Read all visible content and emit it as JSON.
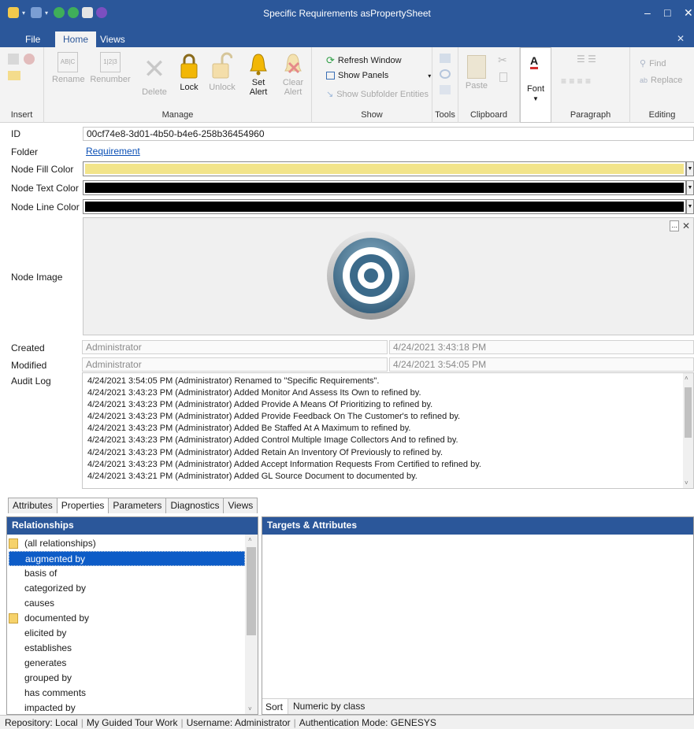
{
  "window": {
    "title": "Specific Requirements asPropertySheet",
    "minimize_glyph": "–",
    "maximize_glyph": "□",
    "close_glyph": "✕"
  },
  "ribbon_tabs": [
    {
      "label": "File"
    },
    {
      "label": "Home"
    },
    {
      "label": "Views"
    }
  ],
  "ribbon": {
    "groups": {
      "insert": "Insert",
      "manage": "Manage",
      "show": "Show",
      "tools": "Tools",
      "clipboard": "Clipboard",
      "paragraph": "Paragraph",
      "editing": "Editing"
    },
    "buttons": {
      "rename": "Rename",
      "renumber": "Renumber",
      "delete": "Delete",
      "lock": "Lock",
      "unlock": "Unlock",
      "set_alert": "Set Alert",
      "clear_alert": "Clear Alert",
      "refresh_window": "Refresh Window",
      "show_panels": "Show Panels",
      "show_subfolder_entities": "Show Subfolder Entities",
      "paste": "Paste",
      "font": "Font",
      "find": "Find",
      "replace": "Replace",
      "rename_icon_text": "AB|C",
      "renumber_icon_text": "1|2|3"
    }
  },
  "properties": {
    "id_label": "ID",
    "id_value": "00cf74e8-3d01-4b50-b4e6-258b36454960",
    "folder_label": "Folder",
    "folder_value": "Requirement",
    "fill_label": "Node Fill Color",
    "fill_color": "#f2e48a",
    "text_label": "Node Text Color",
    "text_color": "#000000",
    "line_label": "Node Line Color",
    "line_color": "#000000",
    "image_label": "Node Image",
    "image_browse": "...",
    "image_clear": "✕",
    "created_label": "Created",
    "created_by": "Administrator",
    "created_at": "4/24/2021 3:43:18 PM",
    "modified_label": "Modified",
    "modified_by": "Administrator",
    "modified_at": "4/24/2021 3:54:05 PM",
    "audit_label": "Audit Log",
    "audit_log": [
      "4/24/2021 3:54:05 PM (Administrator) Renamed to \"Specific Requirements\".",
      "4/24/2021 3:43:23 PM (Administrator) Added Monitor And Assess Its Own to refined by.",
      "4/24/2021 3:43:23 PM (Administrator) Added Provide A Means Of Prioritizing to refined by.",
      "4/24/2021 3:43:23 PM (Administrator) Added Provide Feedback On The Customer's to refined by.",
      "4/24/2021 3:43:23 PM (Administrator) Added Be Staffed At A Maximum to refined by.",
      "4/24/2021 3:43:23 PM (Administrator) Added Control Multiple Image Collectors And to refined by.",
      "4/24/2021 3:43:23 PM (Administrator) Added Retain An Inventory Of Previously to refined by.",
      "4/24/2021 3:43:23 PM (Administrator) Added Accept Information Requests From Certified to refined by.",
      "4/24/2021 3:43:21 PM (Administrator) Added GL Source Document to documented by."
    ]
  },
  "bottom_tabs": [
    {
      "label": "Attributes"
    },
    {
      "label": "Properties"
    },
    {
      "label": "Parameters"
    },
    {
      "label": "Diagnostics"
    },
    {
      "label": "Views"
    }
  ],
  "relationships": {
    "header": "Relationships",
    "items": [
      {
        "label": "(all relationships)"
      },
      {
        "label": "augmented by"
      },
      {
        "label": "basis of"
      },
      {
        "label": "categorized by"
      },
      {
        "label": "causes"
      },
      {
        "label": "documented by"
      },
      {
        "label": "elicited by"
      },
      {
        "label": "establishes"
      },
      {
        "label": "generates"
      },
      {
        "label": "grouped by"
      },
      {
        "label": "has comments"
      },
      {
        "label": "impacted by"
      }
    ]
  },
  "targets": {
    "header": "Targets & Attributes",
    "sort_label": "Sort",
    "sort_value": "Numeric by class"
  },
  "status": [
    "Repository: Local",
    "My Guided Tour Work",
    "Username: Administrator",
    "Authentication Mode: GENESYS"
  ]
}
